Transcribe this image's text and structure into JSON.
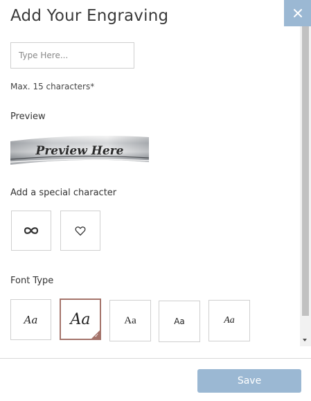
{
  "dialog": {
    "title": "Add Your Engraving",
    "close_icon": "close-icon"
  },
  "engraving": {
    "placeholder": "Type Here...",
    "value": "",
    "note": "Max. 15 characters*"
  },
  "preview": {
    "label": "Preview",
    "text": "Preview Here"
  },
  "special_characters": {
    "label": "Add a special character",
    "items": [
      {
        "name": "infinity",
        "glyph": "∞",
        "icon": "infinity-icon"
      },
      {
        "name": "heart",
        "glyph": "♡",
        "icon": "heart-icon"
      }
    ]
  },
  "font_type": {
    "label": "Font Type",
    "selected_index": 1,
    "items": [
      {
        "sample": "Aa",
        "style": "gothic-script"
      },
      {
        "sample": "Aa",
        "style": "cursive-script"
      },
      {
        "sample": "Aa",
        "style": "serif"
      },
      {
        "sample": "Aa",
        "style": "sans-serif"
      },
      {
        "sample": "Aa",
        "style": "italic-script"
      }
    ]
  },
  "footer": {
    "save_label": "Save"
  },
  "colors": {
    "accent": "#9bb8d3",
    "selected_border": "#a4736a"
  }
}
